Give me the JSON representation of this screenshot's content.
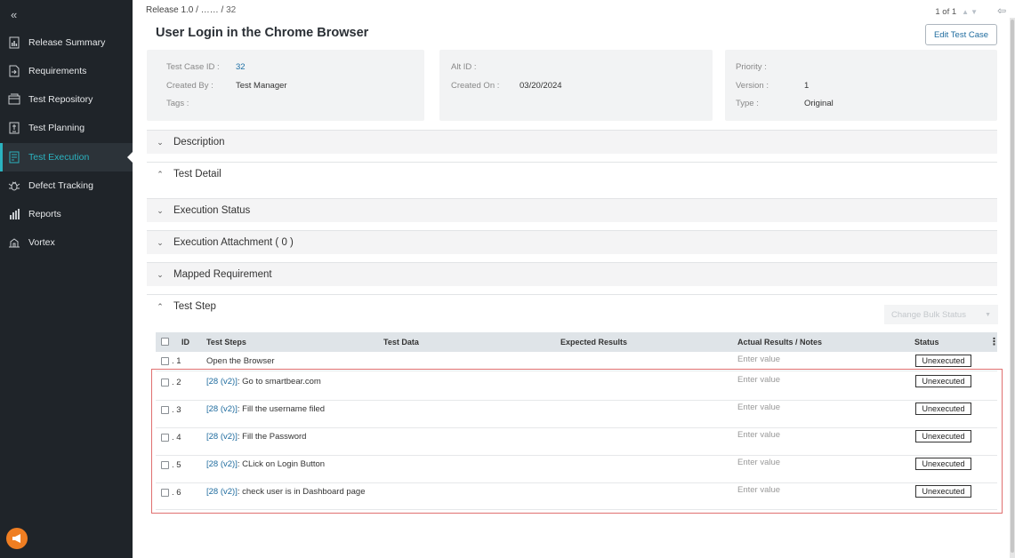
{
  "sidebar": {
    "collapse_icon": "«",
    "items": [
      {
        "label": "Release Summary",
        "icon": "release-summary-icon"
      },
      {
        "label": "Requirements",
        "icon": "requirements-icon"
      },
      {
        "label": "Test Repository",
        "icon": "test-repository-icon"
      },
      {
        "label": "Test Planning",
        "icon": "test-planning-icon"
      },
      {
        "label": "Test Execution",
        "icon": "test-execution-icon",
        "active": true
      },
      {
        "label": "Defect Tracking",
        "icon": "bug-icon"
      },
      {
        "label": "Reports",
        "icon": "reports-icon"
      },
      {
        "label": "Vortex",
        "icon": "vortex-icon"
      }
    ],
    "colors": {
      "background": "#1f2429",
      "active": "#2bb3c0",
      "megaphone": "#ef7e22"
    }
  },
  "header": {
    "breadcrumb_part1": "Release 1.0 /",
    "breadcrumb_part2": "…… /",
    "breadcrumb_part3": "32",
    "pager_text": "1 of 1",
    "title": "User Login in the Chrome Browser",
    "edit_button": "Edit Test Case"
  },
  "meta": {
    "test_case_id_label": "Test Case ID :",
    "test_case_id_value": "32",
    "created_by_label": "Created By :",
    "created_by_value": "Test Manager",
    "tags_label": "Tags :",
    "alt_id_label": "Alt ID :",
    "created_on_label": "Created On :",
    "created_on_value": "03/20/2024",
    "priority_label": "Priority :",
    "version_label": "Version :",
    "version_value": "1",
    "type_label": "Type :",
    "type_value": "Original"
  },
  "sections": {
    "description": "Description",
    "test_detail": "Test Detail",
    "execution_status": "Execution Status",
    "execution_attachment": "Execution Attachment ( 0 )",
    "mapped_requirement": "Mapped Requirement",
    "test_step": "Test Step"
  },
  "bulk_status": "Change Bulk Status",
  "table": {
    "headers": {
      "id": "ID",
      "steps": "Test Steps",
      "data": "Test Data",
      "expected": "Expected Results",
      "actual": "Actual Results / Notes",
      "status": "Status",
      "menu": "⋮"
    },
    "rows": [
      {
        "id": "1",
        "ref": "",
        "step": "Open the Browser",
        "actual": "Enter value",
        "status": "Unexecuted"
      },
      {
        "id": "2",
        "ref": "[28 (v2)]",
        "step": ": Go to smartbear.com",
        "actual": "Enter value",
        "status": "Unexecuted"
      },
      {
        "id": "3",
        "ref": "[28 (v2)]",
        "step": ": Fill the username filed",
        "actual": "Enter value",
        "status": "Unexecuted"
      },
      {
        "id": "4",
        "ref": "[28 (v2)]",
        "step": ": Fill the Password",
        "actual": "Enter value",
        "status": "Unexecuted"
      },
      {
        "id": "5",
        "ref": "[28 (v2)]",
        "step": ": CLick on Login Button",
        "actual": "Enter value",
        "status": "Unexecuted"
      },
      {
        "id": "6",
        "ref": "[28 (v2)]",
        "step": ": check user is in Dashboard page",
        "actual": "Enter value",
        "status": "Unexecuted"
      }
    ]
  },
  "highlight_color": "#e07070"
}
